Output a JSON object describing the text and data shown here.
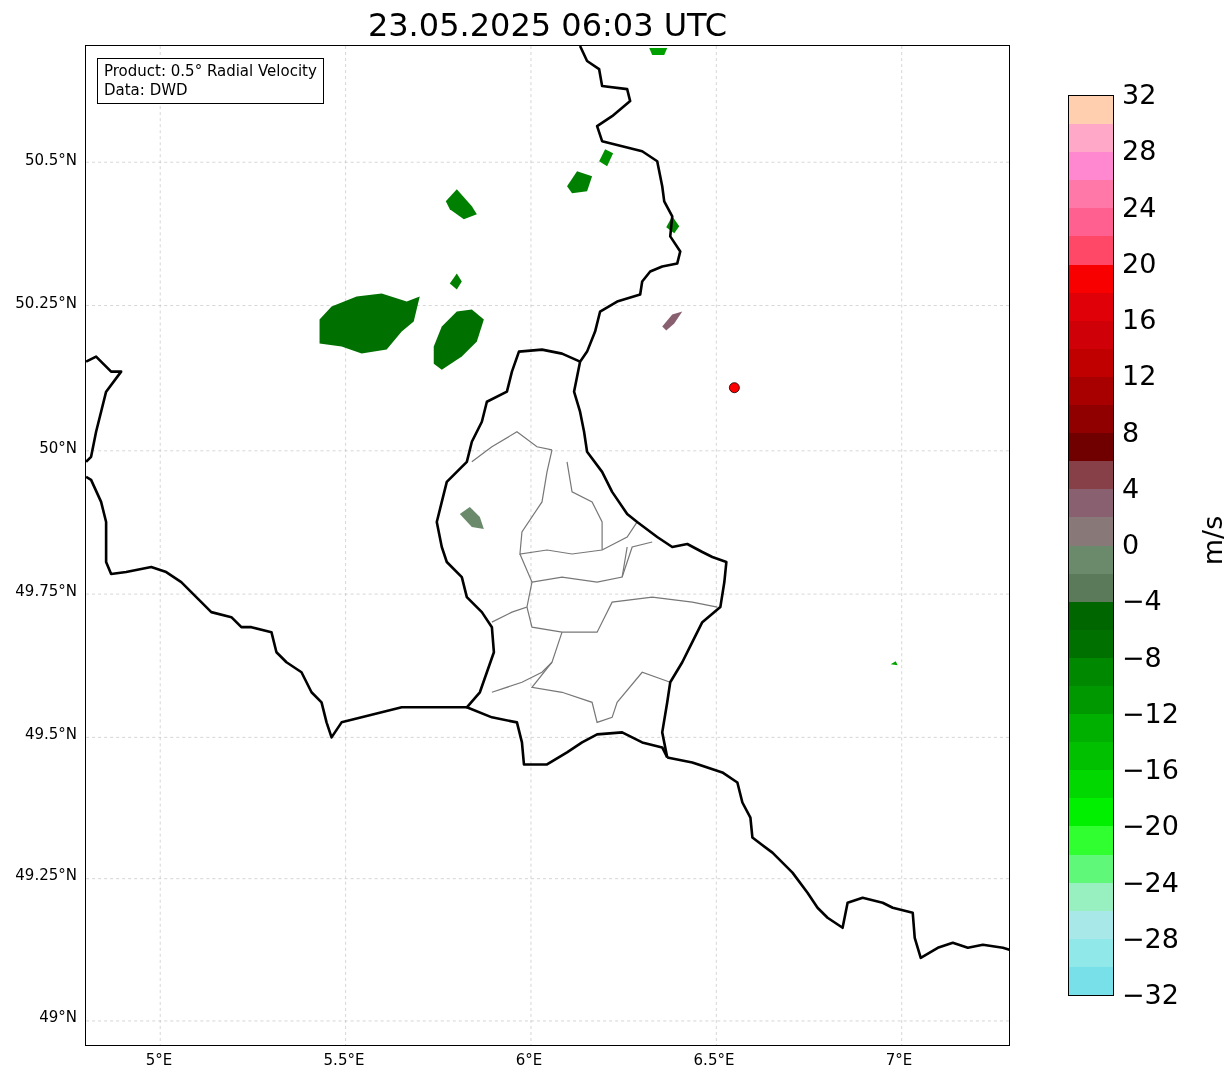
{
  "title": "23.05.2025 06:03 UTC",
  "info_box": {
    "lines": [
      "Product: 0.5° Radial Velocity",
      "Data: DWD"
    ]
  },
  "y_ticks": [
    "50.5°N",
    "50.25°N",
    "50°N",
    "49.75°N",
    "49.5°N",
    "49.25°N",
    "49°N"
  ],
  "x_ticks": [
    "5°E",
    "5.5°E",
    "6°E",
    "6.5°E",
    "7°E"
  ],
  "colorbar": {
    "label": "m/s",
    "ticks": [
      "32",
      "28",
      "24",
      "20",
      "16",
      "12",
      "8",
      "4",
      "0",
      "−4",
      "−8",
      "−12",
      "−16",
      "−20",
      "−24",
      "−28",
      "−32"
    ],
    "segments": [
      {
        "color": "#ffcfb0"
      },
      {
        "color": "#ffa8c8"
      },
      {
        "color": "#ff88d0"
      },
      {
        "color": "#ff78a8"
      },
      {
        "color": "#ff6090"
      },
      {
        "color": "#ff4868"
      },
      {
        "color": "#f80000"
      },
      {
        "color": "#e00008"
      },
      {
        "color": "#d00008"
      },
      {
        "color": "#c00000"
      },
      {
        "color": "#a80000"
      },
      {
        "color": "#900000"
      },
      {
        "color": "#700000"
      },
      {
        "color": "#884048"
      },
      {
        "color": "#886070"
      },
      {
        "color": "#887878"
      },
      {
        "color": "#6b8a6b"
      },
      {
        "color": "#5a7a5a"
      },
      {
        "color": "#006600"
      },
      {
        "color": "#007000"
      },
      {
        "color": "#008800"
      },
      {
        "color": "#009800"
      },
      {
        "color": "#00b000"
      },
      {
        "color": "#00c000"
      },
      {
        "color": "#00d800"
      },
      {
        "color": "#00f000"
      },
      {
        "color": "#30ff30"
      },
      {
        "color": "#60f878"
      },
      {
        "color": "#98f0c0"
      },
      {
        "color": "#a8e8e8"
      },
      {
        "color": "#90e8e8"
      },
      {
        "color": "#78e0e8"
      }
    ]
  }
}
